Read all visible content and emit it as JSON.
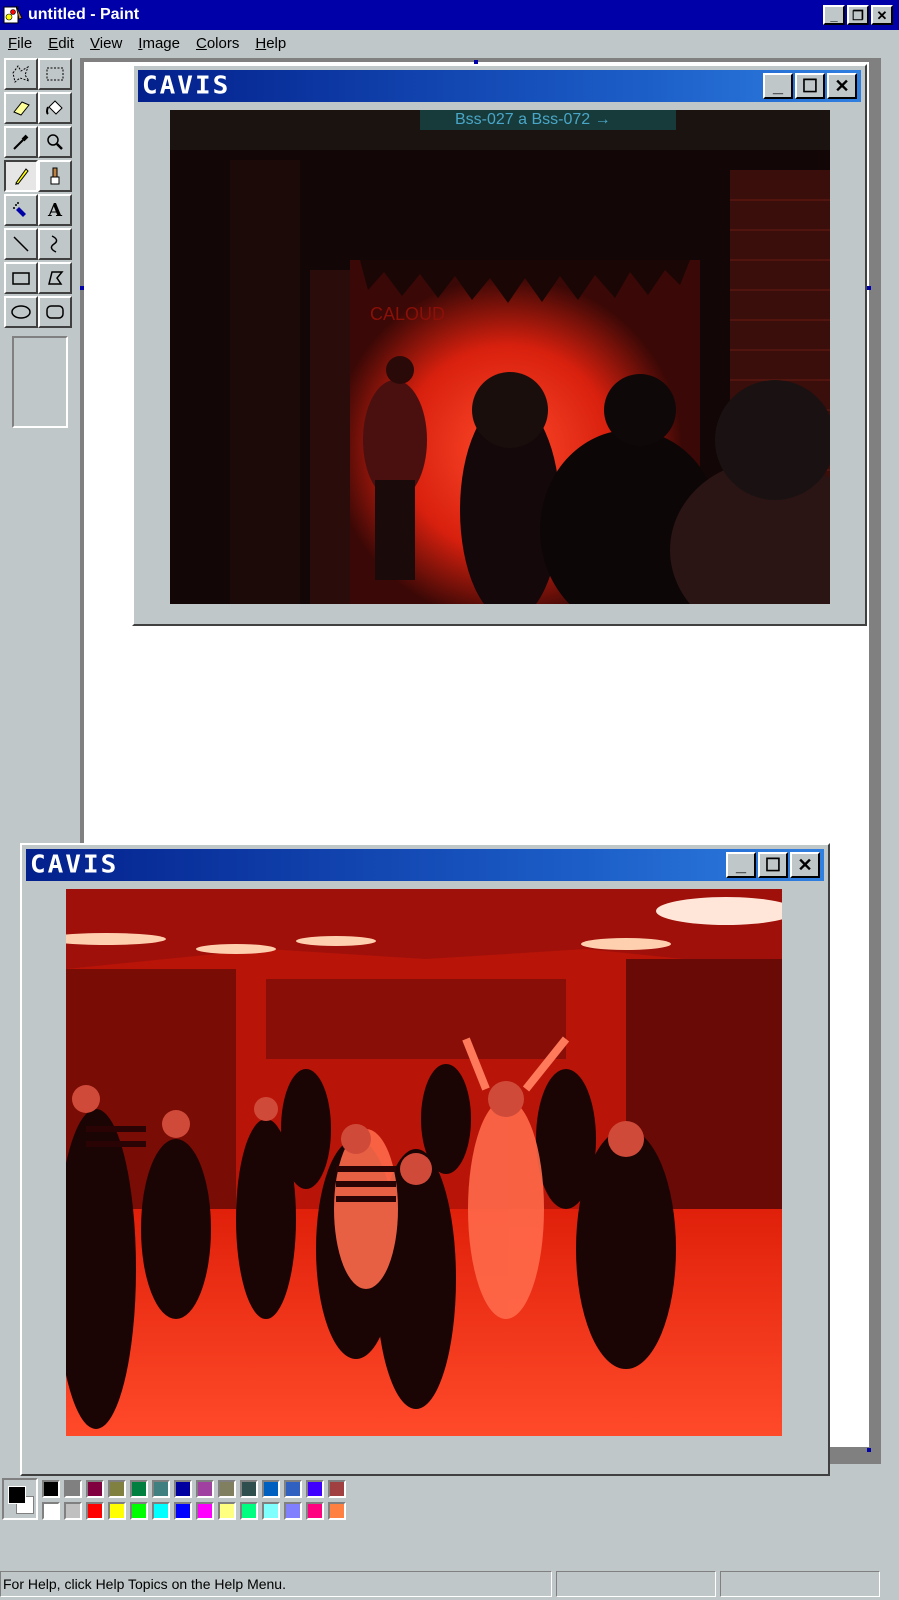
{
  "app": {
    "title": "untitled - Paint"
  },
  "window_controls": {
    "minimize": "_",
    "restore": "❐",
    "close": "✕"
  },
  "menu": [
    "File",
    "Edit",
    "View",
    "Image",
    "Colors",
    "Help"
  ],
  "tools": [
    "free-form-select",
    "select",
    "eraser",
    "fill-with-color",
    "pick-color",
    "magnifier",
    "pencil",
    "brush",
    "airbrush",
    "text",
    "line",
    "curve",
    "rectangle",
    "polygon",
    "ellipse",
    "rounded-rectangle"
  ],
  "selected_tool": "pencil",
  "photo_windows": [
    {
      "title": "CAVIS",
      "photo_sign": "Bss-027 a Bss-072 →",
      "photo_wall_text": "CALOUD"
    },
    {
      "title": "CAVIS"
    }
  ],
  "photo_controls": {
    "minimize": "_",
    "maximize": "☐",
    "close": "✕"
  },
  "palette": {
    "foreground": "#000000",
    "background": "#ffffff",
    "top_row": [
      "#000000",
      "#808080",
      "#800040",
      "#808040",
      "#008040",
      "#408080",
      "#0000a0",
      "#a040a0",
      "#808060",
      "#2f4f4f",
      "#0060c0",
      "#3060c0",
      "#4000ff",
      "#a04040"
    ],
    "bottom_row": [
      "#ffffff",
      "#c0c0c0",
      "#ff0000",
      "#ffff00",
      "#00ff00",
      "#00ffff",
      "#0000ff",
      "#ff00ff",
      "#ffff80",
      "#00ff80",
      "#80ffff",
      "#8080ff",
      "#ff0080",
      "#ff8040"
    ]
  },
  "status": {
    "help_text": "For Help, click Help Topics on the Help Menu.",
    "coords": "",
    "size": ""
  }
}
